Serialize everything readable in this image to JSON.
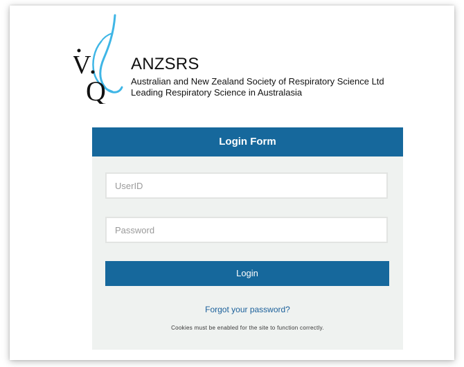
{
  "brand": {
    "logo_letters": "VQ",
    "name": "ANZSRS",
    "full_name": "Australian and New Zealand Society of Respiratory Science Ltd",
    "tagline": "Leading Respiratory Science in Australasia",
    "accent_color": "#16689c",
    "swirl_color": "#3fb6e6"
  },
  "login_form": {
    "title": "Login Form",
    "userid": {
      "value": "",
      "placeholder": "UserID"
    },
    "password": {
      "value": "",
      "placeholder": "Password"
    },
    "submit_label": "Login",
    "forgot_link": "Forgot your password?",
    "cookie_notice": "Cookies must be enabled for the site to function correctly."
  }
}
